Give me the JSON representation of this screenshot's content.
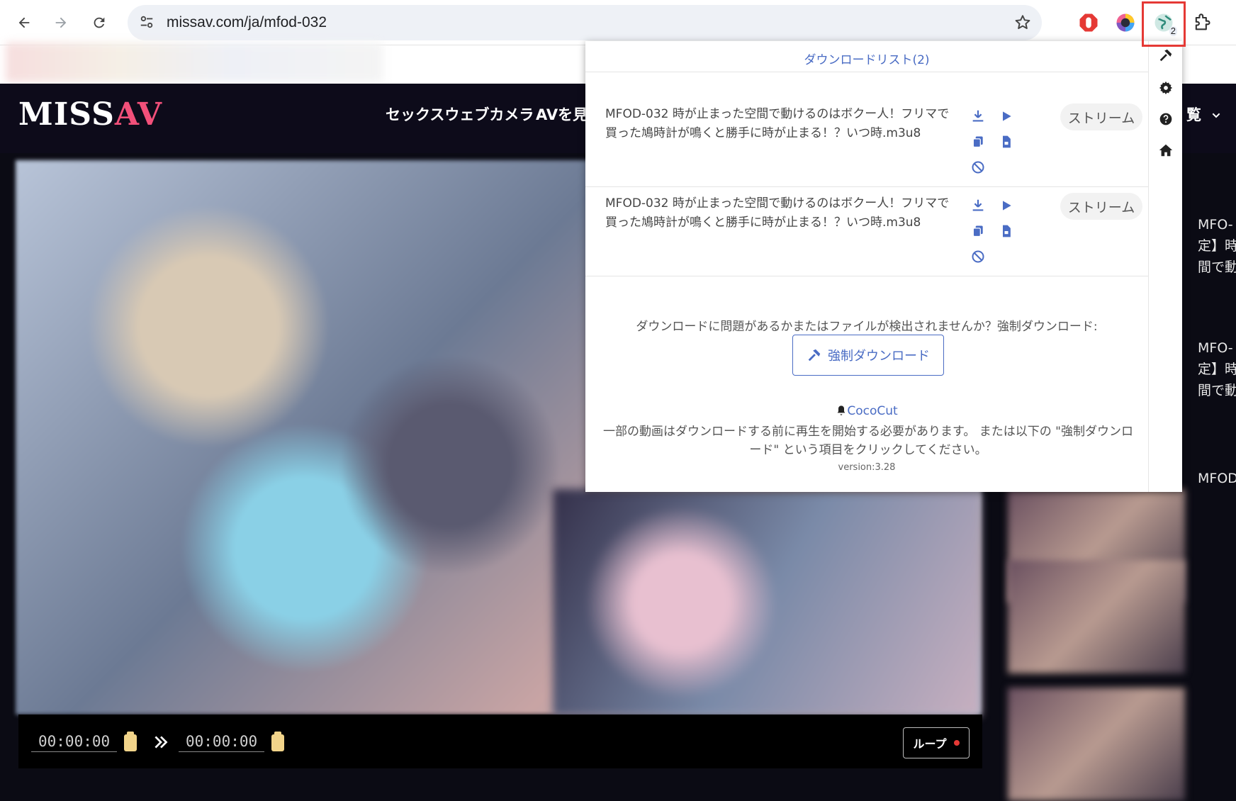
{
  "browser": {
    "url": "missav.com/ja/mfod-032",
    "badge_count": "2"
  },
  "site": {
    "logo_main": "MISS",
    "logo_accent": "AV",
    "nav": [
      "セックスウェブカメラ",
      "AVを見",
      "覧"
    ],
    "right_column_text": [
      "MFO-",
      "定】時",
      "間で動",
      "MFO-",
      "定】時",
      "間で動",
      "MFOD"
    ]
  },
  "player": {
    "start_time": "00:00:00",
    "end_time": "00:00:00",
    "loop_label": "ループ"
  },
  "popup": {
    "title": "ダウンロードリスト(2)",
    "items": [
      {
        "title": "MFOD-032 時が止まった空間で動けるのはボクー人！フリマで買った鳩時計が鳴くと勝手に時が止まる！？いつ時.m3u8",
        "stream_label": "ストリーム"
      },
      {
        "title": "MFOD-032 時が止まった空間で動けるのはボクー人！フリマで買った鳩時計が鳴くと勝手に時が止まる！？いつ時.m3u8",
        "stream_label": "ストリーム"
      }
    ],
    "question": "ダウンロードに問題があるかまたはファイルが検出されませんか？強制ダウンロード:",
    "force_button_label": "強制ダウンロード",
    "brand": "CocoCut",
    "note": "一部の動画はダウンロードする前に再生を開始する必要があります。 または以下の \"強制ダウンロード\" という項目をクリックしてください。",
    "version": "version:3.28"
  },
  "colors": {
    "accent": "#4a6cc4",
    "logo_accent": "#f2507a",
    "highlight": "#e53935"
  }
}
